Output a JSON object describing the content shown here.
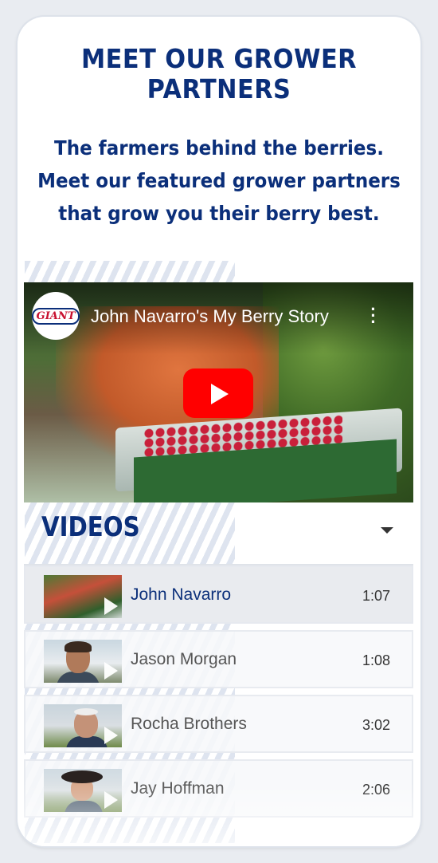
{
  "header": {
    "title": "MEET OUR GROWER PARTNERS",
    "subtitle": "The farmers behind the berries. Meet our featured grower partners that grow you their berry best."
  },
  "video_player": {
    "channel_logo_text": "GIANT",
    "title": "John Navarro's My Berry Story",
    "menu_icon": "kebab-menu-icon",
    "play_icon": "play-icon",
    "play_button_color": "#ff0000"
  },
  "videos_section": {
    "heading": "VIDEOS",
    "toggle_icon": "caret-down-icon",
    "items": [
      {
        "name": "John Navarro",
        "duration": "1:07",
        "selected": true
      },
      {
        "name": "Jason Morgan",
        "duration": "1:08",
        "selected": false
      },
      {
        "name": "Rocha Brothers",
        "duration": "3:02",
        "selected": false
      },
      {
        "name": "Jay Hoffman",
        "duration": "2:06",
        "selected": false
      }
    ]
  },
  "colors": {
    "brand_navy": "#0b2f7a",
    "youtube_red": "#ff0000"
  }
}
